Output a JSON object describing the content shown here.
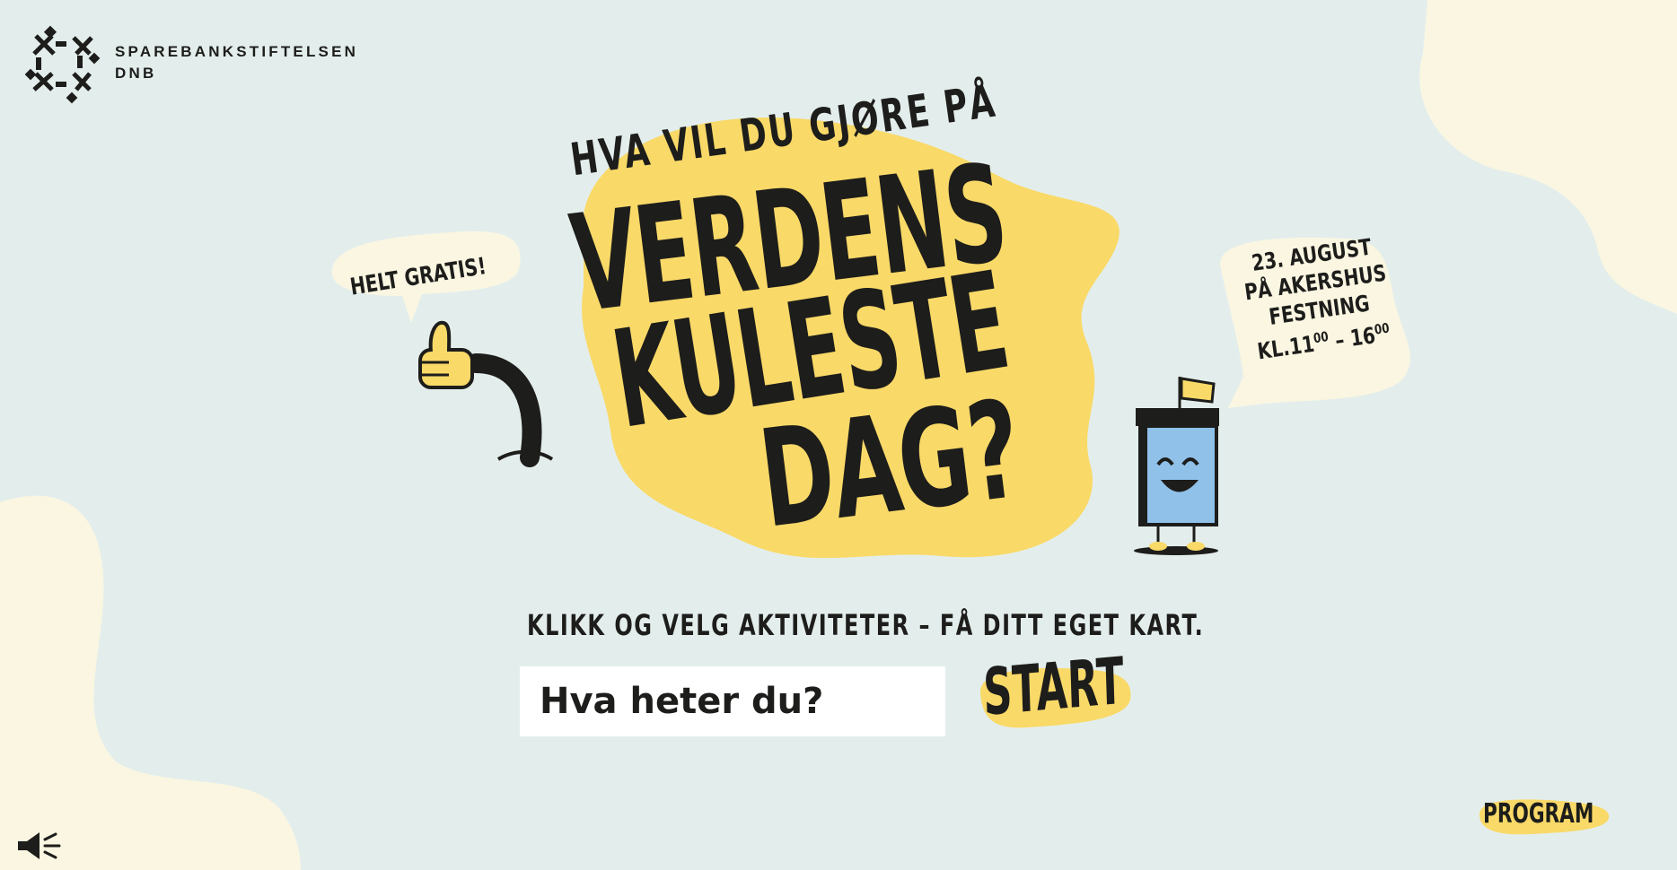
{
  "brand": {
    "line1": "SPAREBANKSTIFTELSEN",
    "line2": "DNB"
  },
  "hero": {
    "kicker": "HVA VIL DU GJØRE PÅ",
    "line1": "VERDENS",
    "line2": "KULESTE",
    "line3": "DAG?"
  },
  "bubble_left": "HELT GRATIS!",
  "bubble_right": {
    "date": "23. AUGUST",
    "place1": "PÅ AKERSHUS",
    "place2": "FESTNING",
    "time_prefix": "KL.",
    "start_h": "11",
    "start_m": "00",
    "sep": "–",
    "end_h": "16",
    "end_m": "00"
  },
  "subtitle": "KLIKK OG VELG AKTIVITETER – FÅ DITT EGET KART.",
  "name_input": {
    "placeholder": "Hva heter du?",
    "value": ""
  },
  "start_label": "START",
  "program_label": "PROGRAM",
  "icons": {
    "sound": "speaker-icon",
    "logo": "sparebankstiftelsen-logo"
  },
  "colors": {
    "background": "#e3eeec",
    "yellow": "#f9d968",
    "cream": "#faf6e2",
    "ink": "#1d1d1b"
  }
}
